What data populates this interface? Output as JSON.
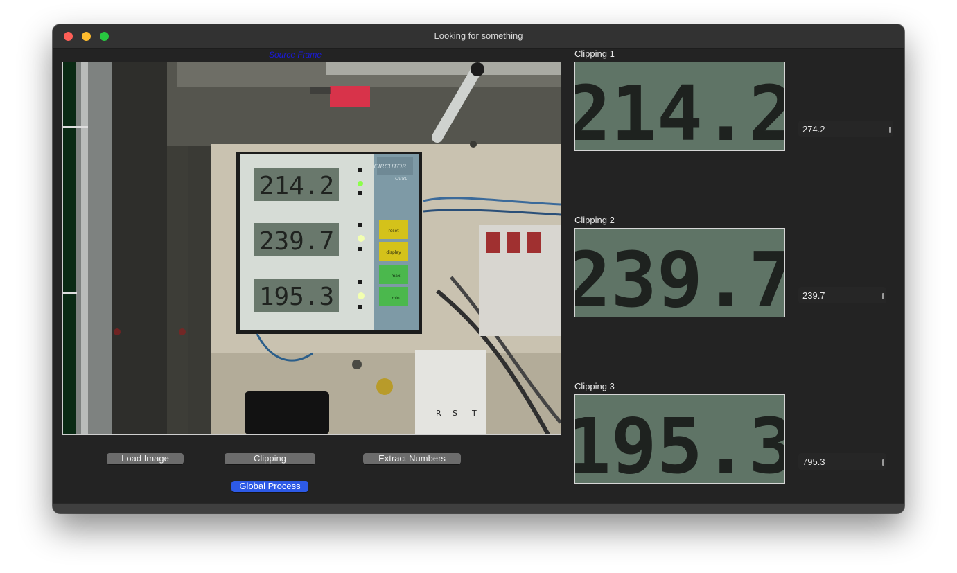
{
  "window": {
    "title": "Looking for something"
  },
  "source": {
    "label": "Source Frame",
    "meters": [
      "214.2",
      "239.7",
      "195.3"
    ],
    "panel_buttons": [
      "reset",
      "display",
      "max",
      "min"
    ],
    "brand": "CIRCUTOR",
    "model": "CV8L",
    "phases": [
      "R",
      "S",
      "T"
    ]
  },
  "buttons": {
    "load_image": "Load  Image",
    "clipping": "Clipping",
    "extract_numbers": "Extract Numbers",
    "global_process": "Global Process"
  },
  "clippings": [
    {
      "label": "Clipping 1",
      "digits": "214.2",
      "value": "274.2"
    },
    {
      "label": "Clipping 2",
      "digits": "239.7",
      "value": "239.7"
    },
    {
      "label": "Clipping 3",
      "digits": "195.3",
      "value": "795.3"
    }
  ],
  "colors": {
    "primary_button": "#2d5ae6",
    "lcd_background": "#5f7466",
    "source_label": "#1a1ad8"
  }
}
